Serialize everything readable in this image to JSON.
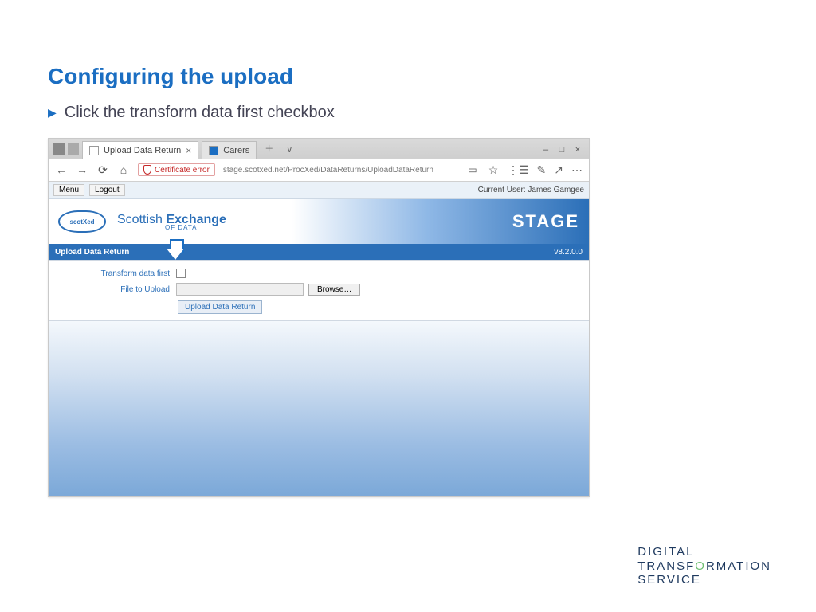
{
  "slide": {
    "title": "Configuring the upload",
    "bullet": "Click the transform data first checkbox"
  },
  "browser": {
    "tabs": [
      {
        "label": "Upload Data Return",
        "active": true
      },
      {
        "label": "Carers",
        "active": false
      }
    ],
    "cert_label": "Certificate error",
    "url": "stage.scotxed.net/ProcXed/DataReturns/UploadDataReturn",
    "window_controls": {
      "min": "–",
      "max": "□",
      "close": "×"
    }
  },
  "app": {
    "menu_btn": "Menu",
    "logout_btn": "Logout",
    "current_user_label": "Current User:",
    "current_user": "James Gamgee",
    "brand_logo_text": "scotXed",
    "brand_line1_a": "Scottish ",
    "brand_line1_b": "Exchange",
    "brand_line2": "OF DATA",
    "stage": "STAGE",
    "bluebar_title": "Upload Data Return",
    "version": "v8.2.0.0",
    "form": {
      "transform_label": "Transform data first",
      "file_label": "File to Upload",
      "browse": "Browse…",
      "submit": "Upload Data Return"
    }
  },
  "footer": {
    "line1": "DIGITAL",
    "line2_a": "TRANSF",
    "line2_b": "RMATION",
    "line3": "SERVICE"
  }
}
